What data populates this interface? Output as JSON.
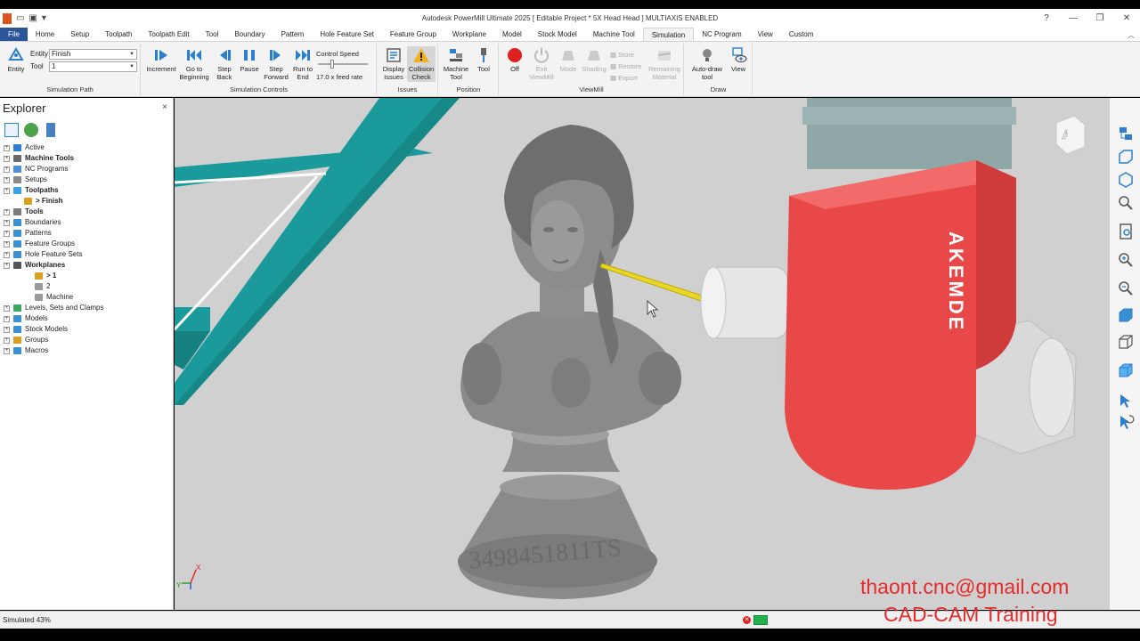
{
  "window": {
    "title": "Autodesk PowerMill Ultimate 2025   [ Editable Project * 5X Head Head ]   MULTIAXIS ENABLED",
    "help_icon": "?",
    "minimize": "—",
    "restore": "❐",
    "close": "✕"
  },
  "tabs": [
    {
      "label": "File"
    },
    {
      "label": "Home"
    },
    {
      "label": "Setup"
    },
    {
      "label": "Toolpath"
    },
    {
      "label": "Toolpath Edit"
    },
    {
      "label": "Tool"
    },
    {
      "label": "Boundary"
    },
    {
      "label": "Pattern"
    },
    {
      "label": "Hole Feature Set"
    },
    {
      "label": "Feature Group"
    },
    {
      "label": "Workplane"
    },
    {
      "label": "Model"
    },
    {
      "label": "Stock Model"
    },
    {
      "label": "Machine Tool"
    },
    {
      "label": "Simulation"
    },
    {
      "label": "NC Program"
    },
    {
      "label": "View"
    },
    {
      "label": "Custom"
    }
  ],
  "ribbon": {
    "simulation_path": {
      "label": "Simulation Path",
      "entity_button": "Entity",
      "entity_label": "Entity",
      "entity_value": "Finish",
      "tool_label": "Tool",
      "tool_value": "1"
    },
    "simulation_controls": {
      "label": "Simulation Controls",
      "increment": "Increment",
      "go_to_beginning": "Go to Beginning",
      "step_back": "Step Back",
      "pause": "Pause",
      "step_forward": "Step Forward",
      "run_to_end": "Run to End",
      "control_speed": "Control Speed",
      "feed_rate": "17.0 x feed rate"
    },
    "issues": {
      "label": "Issues",
      "display_issues": "Display Issues",
      "collision_check": "Collision Check"
    },
    "position": {
      "label": "Position",
      "machine_tool": "Machine Tool",
      "tool": "Tool"
    },
    "viewmill": {
      "label": "ViewMill",
      "off": "Off",
      "exit_viewmill": "Exit ViewMill",
      "mode": "Mode",
      "shading": "Shading",
      "store": "Store",
      "restore": "Restore",
      "export": "Export",
      "remaining_material": "Remaining Material"
    },
    "draw": {
      "label": "Draw",
      "auto_draw_tool": "Auto-draw tool",
      "view": "View"
    }
  },
  "explorer": {
    "title": "Explorer",
    "close": "×",
    "tree": [
      {
        "label": "Active",
        "level": 0,
        "bold": false,
        "icon_color": "#2f7fd0"
      },
      {
        "label": "Machine Tools",
        "level": 0,
        "bold": true,
        "icon_color": "#6a6a6a"
      },
      {
        "label": "NC Programs",
        "level": 0,
        "bold": false,
        "icon_color": "#4a90d9"
      },
      {
        "label": "Setups",
        "level": 0,
        "bold": false,
        "icon_color": "#8a8a8a"
      },
      {
        "label": "Toolpaths",
        "level": 0,
        "bold": true,
        "icon_color": "#3aa0e0"
      },
      {
        "label": "> Finish",
        "level": 1,
        "bold": true,
        "icon_color": "#d9a020"
      },
      {
        "label": "Tools",
        "level": 0,
        "bold": true,
        "icon_color": "#7a7a7a"
      },
      {
        "label": "Boundaries",
        "level": 0,
        "bold": false,
        "icon_color": "#3a8fd0"
      },
      {
        "label": "Patterns",
        "level": 0,
        "bold": false,
        "icon_color": "#3a8fd0"
      },
      {
        "label": "Feature Groups",
        "level": 0,
        "bold": false,
        "icon_color": "#3a8fd0"
      },
      {
        "label": "Hole Feature Sets",
        "level": 0,
        "bold": false,
        "icon_color": "#3a8fd0"
      },
      {
        "label": "Workplanes",
        "level": 0,
        "bold": true,
        "icon_color": "#555555"
      },
      {
        "label": "> 1",
        "level": 2,
        "bold": true,
        "icon_color": "#d9a020"
      },
      {
        "label": "2",
        "level": 2,
        "bold": false,
        "icon_color": "#999999"
      },
      {
        "label": "Machine",
        "level": 2,
        "bold": false,
        "icon_color": "#999999"
      },
      {
        "label": "Levels, Sets and Clamps",
        "level": 0,
        "bold": false,
        "icon_color": "#3aa860"
      },
      {
        "label": "Models",
        "level": 0,
        "bold": false,
        "icon_color": "#3a8fd0"
      },
      {
        "label": "Stock Models",
        "level": 0,
        "bold": false,
        "icon_color": "#3a8fd0"
      },
      {
        "label": "Groups",
        "level": 0,
        "bold": false,
        "icon_color": "#d9a020"
      },
      {
        "label": "Macros",
        "level": 0,
        "bold": false,
        "icon_color": "#3a8fd0"
      }
    ]
  },
  "viewport": {
    "head_text": "AKEMDE",
    "base_text": "3498451811TS",
    "view_cube_label": "TOP",
    "axis_x": "X",
    "axis_y": "Y"
  },
  "status": {
    "text": "Simulated 43%",
    "progress_percent": 43
  },
  "watermark": {
    "email": "thaont.cnc@gmail.com",
    "training": "CAD-CAM Training"
  },
  "colors": {
    "accent": "#2b579a",
    "head_red": "#e84848",
    "fixture_teal": "#1a9a9a",
    "watermark_red": "#e52b2b"
  }
}
